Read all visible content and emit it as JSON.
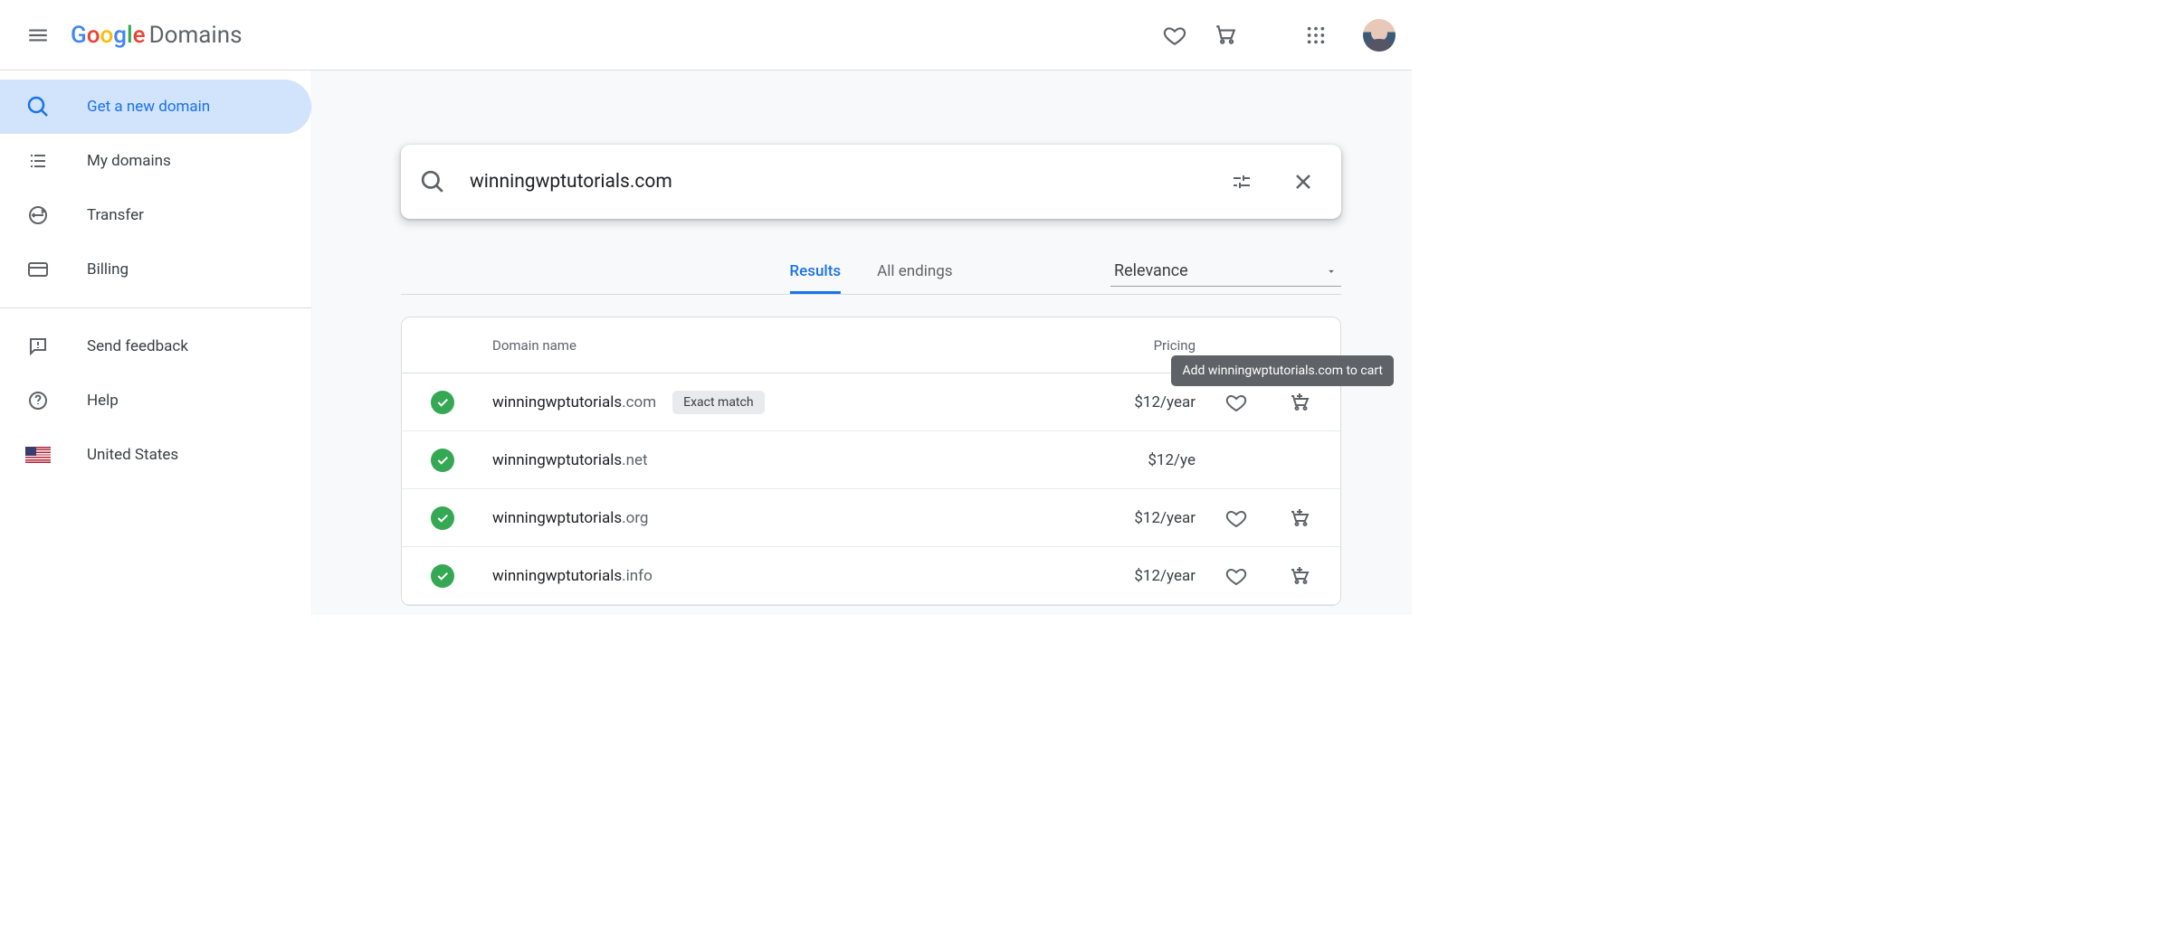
{
  "header": {
    "logo_product": "Domains"
  },
  "sidebar": {
    "items": [
      {
        "label": "Get a new domain"
      },
      {
        "label": "My domains"
      },
      {
        "label": "Transfer"
      },
      {
        "label": "Billing"
      },
      {
        "label": "Send feedback"
      },
      {
        "label": "Help"
      },
      {
        "label": "United States"
      }
    ]
  },
  "search": {
    "value": "winningwptutorials.com"
  },
  "tabs": {
    "results": "Results",
    "all_endings": "All endings"
  },
  "sort": {
    "selected": "Relevance"
  },
  "table": {
    "header_domain": "Domain name",
    "header_pricing": "Pricing",
    "rows": [
      {
        "base": "winningwptutorials",
        "tld": ".com",
        "badge": "Exact match",
        "price": "$12/year"
      },
      {
        "base": "winningwptutorials",
        "tld": ".net",
        "badge": "",
        "price": "$12/ye"
      },
      {
        "base": "winningwptutorials",
        "tld": ".org",
        "badge": "",
        "price": "$12/year"
      },
      {
        "base": "winningwptutorials",
        "tld": ".info",
        "badge": "",
        "price": "$12/year"
      }
    ]
  },
  "tooltip": {
    "text": "Add winningwptutorials.com to cart"
  }
}
